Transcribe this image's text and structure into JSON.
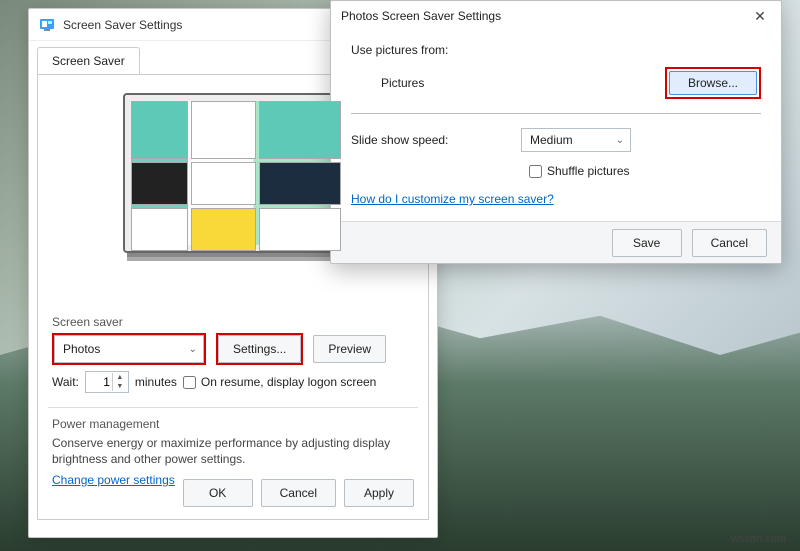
{
  "watermark": "wsxdn.com",
  "window1": {
    "title": "Screen Saver Settings",
    "tab": "Screen Saver",
    "section_screen_saver": "Screen saver",
    "dropdown_value": "Photos",
    "settings_button": "Settings...",
    "preview_button": "Preview",
    "wait_label": "Wait:",
    "wait_value": "1",
    "minutes_label": "minutes",
    "on_resume_label": "On resume, display logon screen",
    "power_mgmt_label": "Power management",
    "power_mgmt_text": "Conserve energy or maximize performance by adjusting display brightness and other power settings.",
    "power_link": "Change power settings",
    "ok": "OK",
    "cancel": "Cancel",
    "apply": "Apply"
  },
  "window2": {
    "title": "Photos Screen Saver Settings",
    "use_pictures_from": "Use pictures from:",
    "pictures_value": "Pictures",
    "browse": "Browse...",
    "slide_speed_label": "Slide show speed:",
    "slide_speed_value": "Medium",
    "shuffle_label": "Shuffle pictures",
    "help_link": "How do I customize my screen saver?",
    "save": "Save",
    "cancel": "Cancel"
  }
}
